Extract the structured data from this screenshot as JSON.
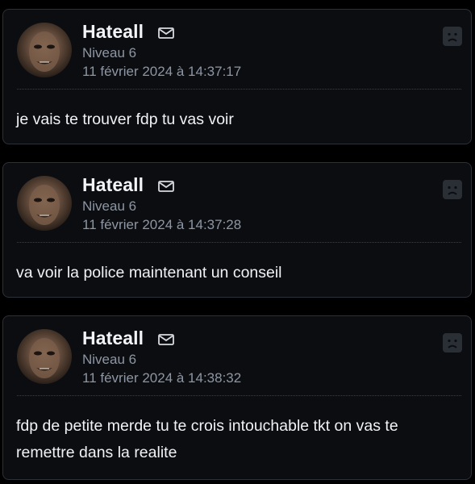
{
  "posts": [
    {
      "username": "Hateall",
      "level": "Niveau 6",
      "date": "11 février 2024 à 14:37:17",
      "message": "je vais te trouver fdp tu vas voir"
    },
    {
      "username": "Hateall",
      "level": "Niveau 6",
      "date": "11 février 2024 à 14:37:28",
      "message": "va voir la police maintenant un conseil"
    },
    {
      "username": "Hateall",
      "level": "Niveau 6",
      "date": "11 février 2024 à 14:38:32",
      "message": "fdp de petite merde tu te crois intouchable tkt on vas te remettre dans la realite"
    }
  ],
  "icons": {
    "avatar": "avatar-image",
    "mail": "mail-icon",
    "report": "sad-face-report-icon"
  },
  "colors": {
    "background": "#000000",
    "card": "#0b0d11",
    "card_border": "#2c3038",
    "username": "#f2f4f7",
    "meta": "#8e96a3",
    "message": "#f0f2f5"
  }
}
